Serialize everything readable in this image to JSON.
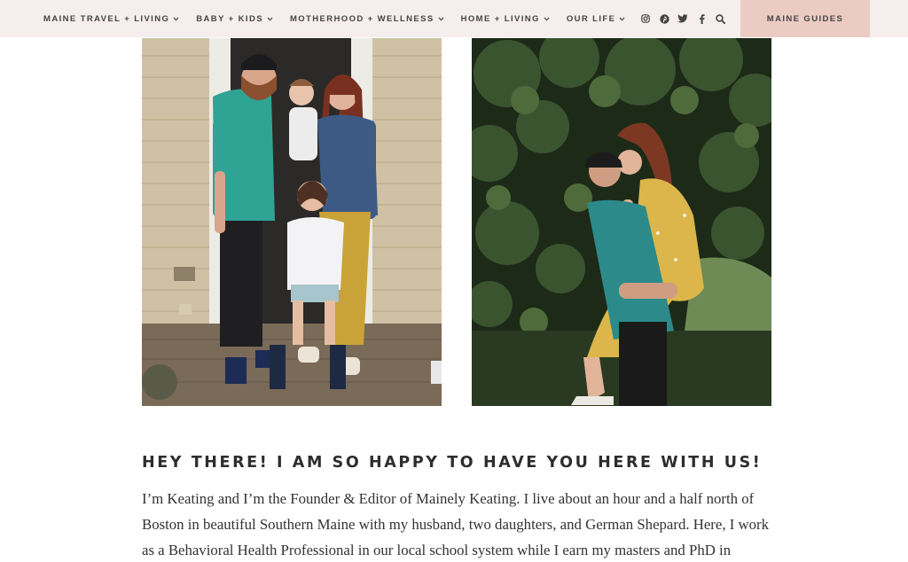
{
  "nav": {
    "items": [
      {
        "label": "MAINE TRAVEL + LIVING"
      },
      {
        "label": "BABY + KIDS"
      },
      {
        "label": "MOTHERHOOD + WELLNESS"
      },
      {
        "label": "HOME + LIVING"
      },
      {
        "label": "OUR LIFE"
      }
    ],
    "social_icons": [
      "instagram-icon",
      "pinterest-icon",
      "twitter-icon",
      "facebook-icon",
      "search-icon"
    ],
    "cta_label": "MAINE GUIDES"
  },
  "colors": {
    "nav_bg": "#f6eeec",
    "cta_bg": "#ebcbc3",
    "text": "#333333"
  },
  "main": {
    "heading": "HEY THERE! I AM SO HAPPY TO HAVE YOU HERE WITH US!",
    "intro": "I’m Keating and I’m the Founder & Editor of Mainely Keating. I live about an hour and a half north of Boston in beautiful Southern Maine with my husband, two daughters, and German Shepard. Here, I work as a Behavioral Health Professional in our local school system while I earn my masters and PhD in psychology."
  }
}
